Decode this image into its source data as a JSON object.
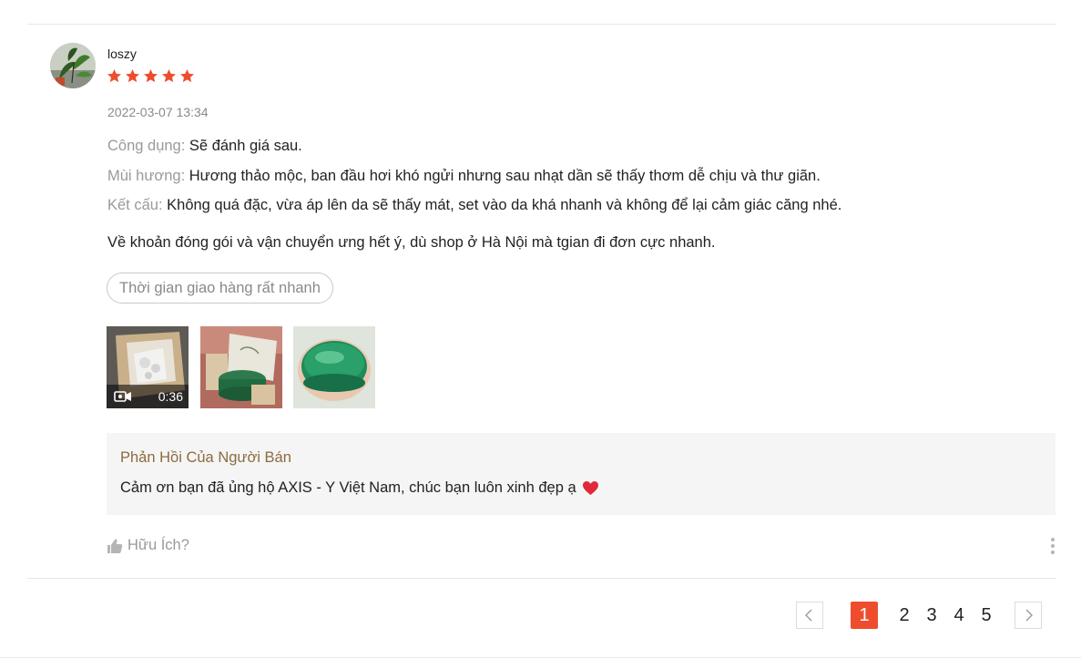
{
  "review": {
    "username": "loszy",
    "rating": 5,
    "date": "2022-03-07 13:34",
    "attributes": [
      {
        "label": "Công dụng:",
        "value": "Sẽ đánh giá sau."
      },
      {
        "label": "Mùi hương:",
        "value": "Hương thảo mộc, ban đầu hơi khó ngửi nhưng sau nhạt dần sẽ thấy thơm dễ chịu và thư giãn."
      },
      {
        "label": "Kết cấu:",
        "value": "Không quá đặc, vừa áp lên da sẽ thấy mát, set vào da khá nhanh và không để lại cảm giác căng nhé."
      }
    ],
    "body": "Về khoản đóng gói và vận chuyển ưng hết ý, dù shop ở Hà Nội mà tgian đi đơn cực nhanh.",
    "tag": "Thời gian giao hàng rất nhanh",
    "media": [
      {
        "type": "video",
        "duration": "0:36"
      },
      {
        "type": "image"
      },
      {
        "type": "image"
      }
    ],
    "seller_reply": {
      "title": "Phản Hồi Của Người Bán",
      "text": "Cảm ơn bạn đã ủng hộ AXIS - Y Việt Nam, chúc bạn luôn xinh đẹp ạ"
    },
    "helpful_label": "Hữu Ích?"
  },
  "pagination": {
    "pages": [
      "1",
      "2",
      "3",
      "4",
      "5"
    ],
    "current": "1"
  },
  "colors": {
    "star": "#ee4d2d",
    "accent": "#ee4d2d",
    "reply_title": "#8d6b3e",
    "heart": "#e0293a"
  },
  "icons": {
    "rating": "star-icon",
    "video": "video-camera-icon",
    "heart": "heart-icon",
    "helpful": "thumbs-up-icon",
    "more": "more-vertical-icon",
    "prev": "chevron-left-icon",
    "next": "chevron-right-icon"
  }
}
